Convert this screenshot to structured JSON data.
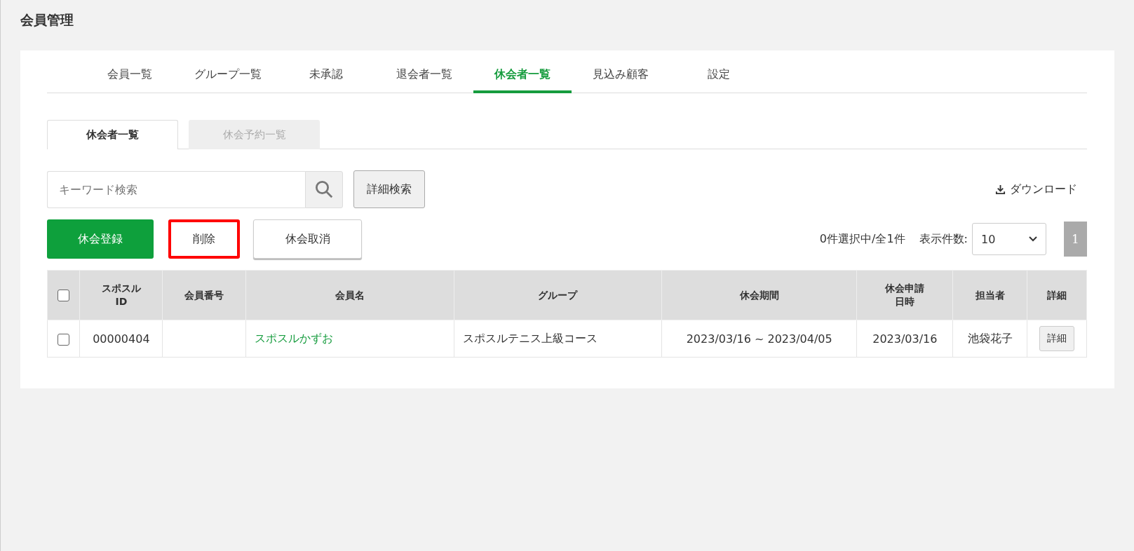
{
  "page_title": "会員管理",
  "nav_tabs": [
    {
      "label": "会員一覧",
      "selected": false
    },
    {
      "label": "グループ一覧",
      "selected": false
    },
    {
      "label": "未承認",
      "selected": false
    },
    {
      "label": "退会者一覧",
      "selected": false
    },
    {
      "label": "休会者一覧",
      "selected": true
    },
    {
      "label": "見込み顧客",
      "selected": false
    },
    {
      "label": "設定",
      "selected": false
    }
  ],
  "sub_tabs": [
    {
      "label": "休会者一覧",
      "selected": true
    },
    {
      "label": "休会予約一覧",
      "selected": false
    }
  ],
  "search": {
    "placeholder": "キーワード検索",
    "advanced_button": "詳細検索"
  },
  "download": "ダウンロード",
  "actions": [
    {
      "label": "休会登録",
      "kind": "primary",
      "highlighted": false
    },
    {
      "label": "削除",
      "kind": "plain",
      "highlighted": true
    },
    {
      "label": "休会取消",
      "kind": "outline",
      "highlighted": false
    }
  ],
  "selection_status": "0件選択中/全1件",
  "page_size": {
    "label": "表示件数:",
    "value": "10"
  },
  "pagination": [
    {
      "label": "1",
      "selected": true
    }
  ],
  "table": {
    "header_checked": false,
    "columns": [
      "スポスル ID",
      "会員番号",
      "会員名",
      "グループ",
      "休会期間",
      "休会申請日時",
      "担当者",
      "詳細"
    ],
    "rows": [
      {
        "checked": false,
        "id": "00000404",
        "member_name": "スポスルかずお",
        "group": "スポスルテニス上級コース",
        "period": "2023/03/16 ~ 2023/04/05",
        "applied": "2023/03/16",
        "staff": "池袋花子",
        "detail_button": "詳細"
      }
    ]
  }
}
